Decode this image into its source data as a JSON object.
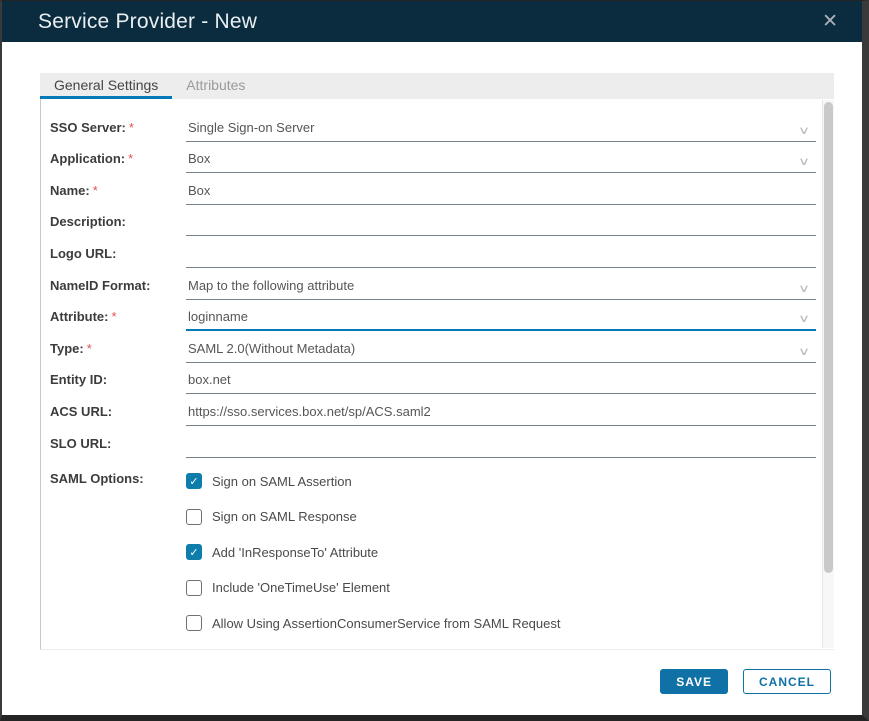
{
  "window": {
    "title": "Service Provider - New",
    "close_icon": "✕"
  },
  "tabs": [
    {
      "label": "General Settings",
      "active": true
    },
    {
      "label": "Attributes",
      "active": false
    }
  ],
  "form": {
    "fields": [
      {
        "label": "SSO Server:",
        "required": true,
        "value": "Single Sign-on Server",
        "type": "select",
        "focused": false
      },
      {
        "label": "Application:",
        "required": true,
        "value": "Box",
        "type": "select",
        "focused": false
      },
      {
        "label": "Name:",
        "required": true,
        "value": "Box",
        "type": "text",
        "focused": false
      },
      {
        "label": "Description:",
        "required": false,
        "value": "",
        "type": "text",
        "focused": false
      },
      {
        "label": "Logo URL:",
        "required": false,
        "value": "",
        "type": "text",
        "focused": false
      },
      {
        "label": "NameID Format:",
        "required": false,
        "value": "Map to the following attribute",
        "type": "select",
        "focused": false
      },
      {
        "label": "Attribute:",
        "required": true,
        "value": "loginname",
        "type": "select",
        "focused": true
      },
      {
        "label": "Type:",
        "required": true,
        "value": "SAML 2.0(Without Metadata)",
        "type": "select",
        "focused": false
      },
      {
        "label": "Entity ID:",
        "required": false,
        "value": "box.net",
        "type": "text",
        "focused": false
      },
      {
        "label": "ACS URL:",
        "required": false,
        "value": "https://sso.services.box.net/sp/ACS.saml2",
        "type": "text",
        "focused": false
      },
      {
        "label": "SLO URL:",
        "required": false,
        "value": "",
        "type": "text",
        "focused": false
      }
    ],
    "saml_options": {
      "label": "SAML Options:",
      "checkboxes": [
        {
          "label": "Sign on SAML Assertion",
          "checked": true
        },
        {
          "label": "Sign on SAML Response",
          "checked": false
        },
        {
          "label": "Add 'InResponseTo' Attribute",
          "checked": true
        },
        {
          "label": "Include 'OneTimeUse' Element",
          "checked": false
        },
        {
          "label": "Allow Using AssertionConsumerService from SAML Request",
          "checked": false
        }
      ],
      "check_glyph": "✓"
    },
    "select_chevron_glyph": "∨"
  },
  "footer": {
    "save_label": "SAVE",
    "cancel_label": "CANCEL"
  },
  "colors": {
    "header_bg": "#0b2c3e",
    "accent_blue": "#0079b8",
    "checkbox_blue": "#0e7dab",
    "button_blue": "#0f71a6",
    "required_red": "#e0524e",
    "tabbar_bg": "#ededed",
    "underline_gray": "#76838c"
  }
}
